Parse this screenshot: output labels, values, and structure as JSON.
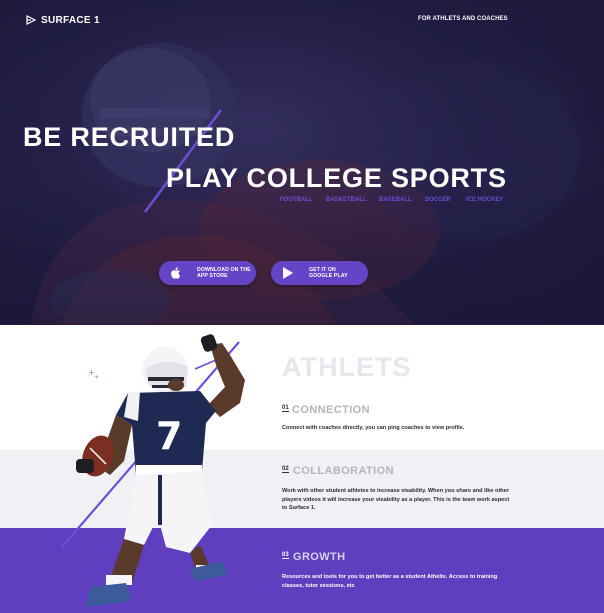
{
  "brand": {
    "name": "SURFACE 1",
    "logo_icon": "surface-logo-icon"
  },
  "nav": {
    "top_link": "FOR ATHLETS AND COACHES"
  },
  "hero": {
    "headline_line_1": "BE RECRUITED",
    "headline_line_2": "PLAY COLLEGE SPORTS",
    "sports": [
      "FOOTBALL",
      "BASKETBALL",
      "BASEBALL",
      "SOCCER",
      "ICE HOCKEY"
    ],
    "app_store": {
      "icon": "apple-icon",
      "line_1": "DOWNLOAD ON THE",
      "line_2": "APP STORE"
    },
    "google_play": {
      "icon": "play-icon",
      "line_1": "GET IT ON",
      "line_2": "GOOGLE PLAY"
    }
  },
  "athlets": {
    "title": "ATHLETS",
    "features": [
      {
        "number": "01",
        "title": "CONNECTION",
        "text": "Connect with coaches directly, you can ping coaches to view profile."
      },
      {
        "number": "02",
        "title": "COLLABORATION",
        "text": "Work with other student athletes to increase visability. When you share and like other players videos it will increase your visability as a player. This is the team work aspect to Surface 1."
      },
      {
        "number": "03",
        "title": "GROWTH",
        "text": "Resources and tools for you to get better as a student Athelte. Access to training classes, tutor sessions, etc"
      }
    ]
  },
  "colors": {
    "hero_bg": "#25214a",
    "accent_purple": "#6544c7",
    "sport_link": "#6d4fd6",
    "growth_band": "#5f3ec0",
    "collab_band": "#f1f0f4"
  }
}
